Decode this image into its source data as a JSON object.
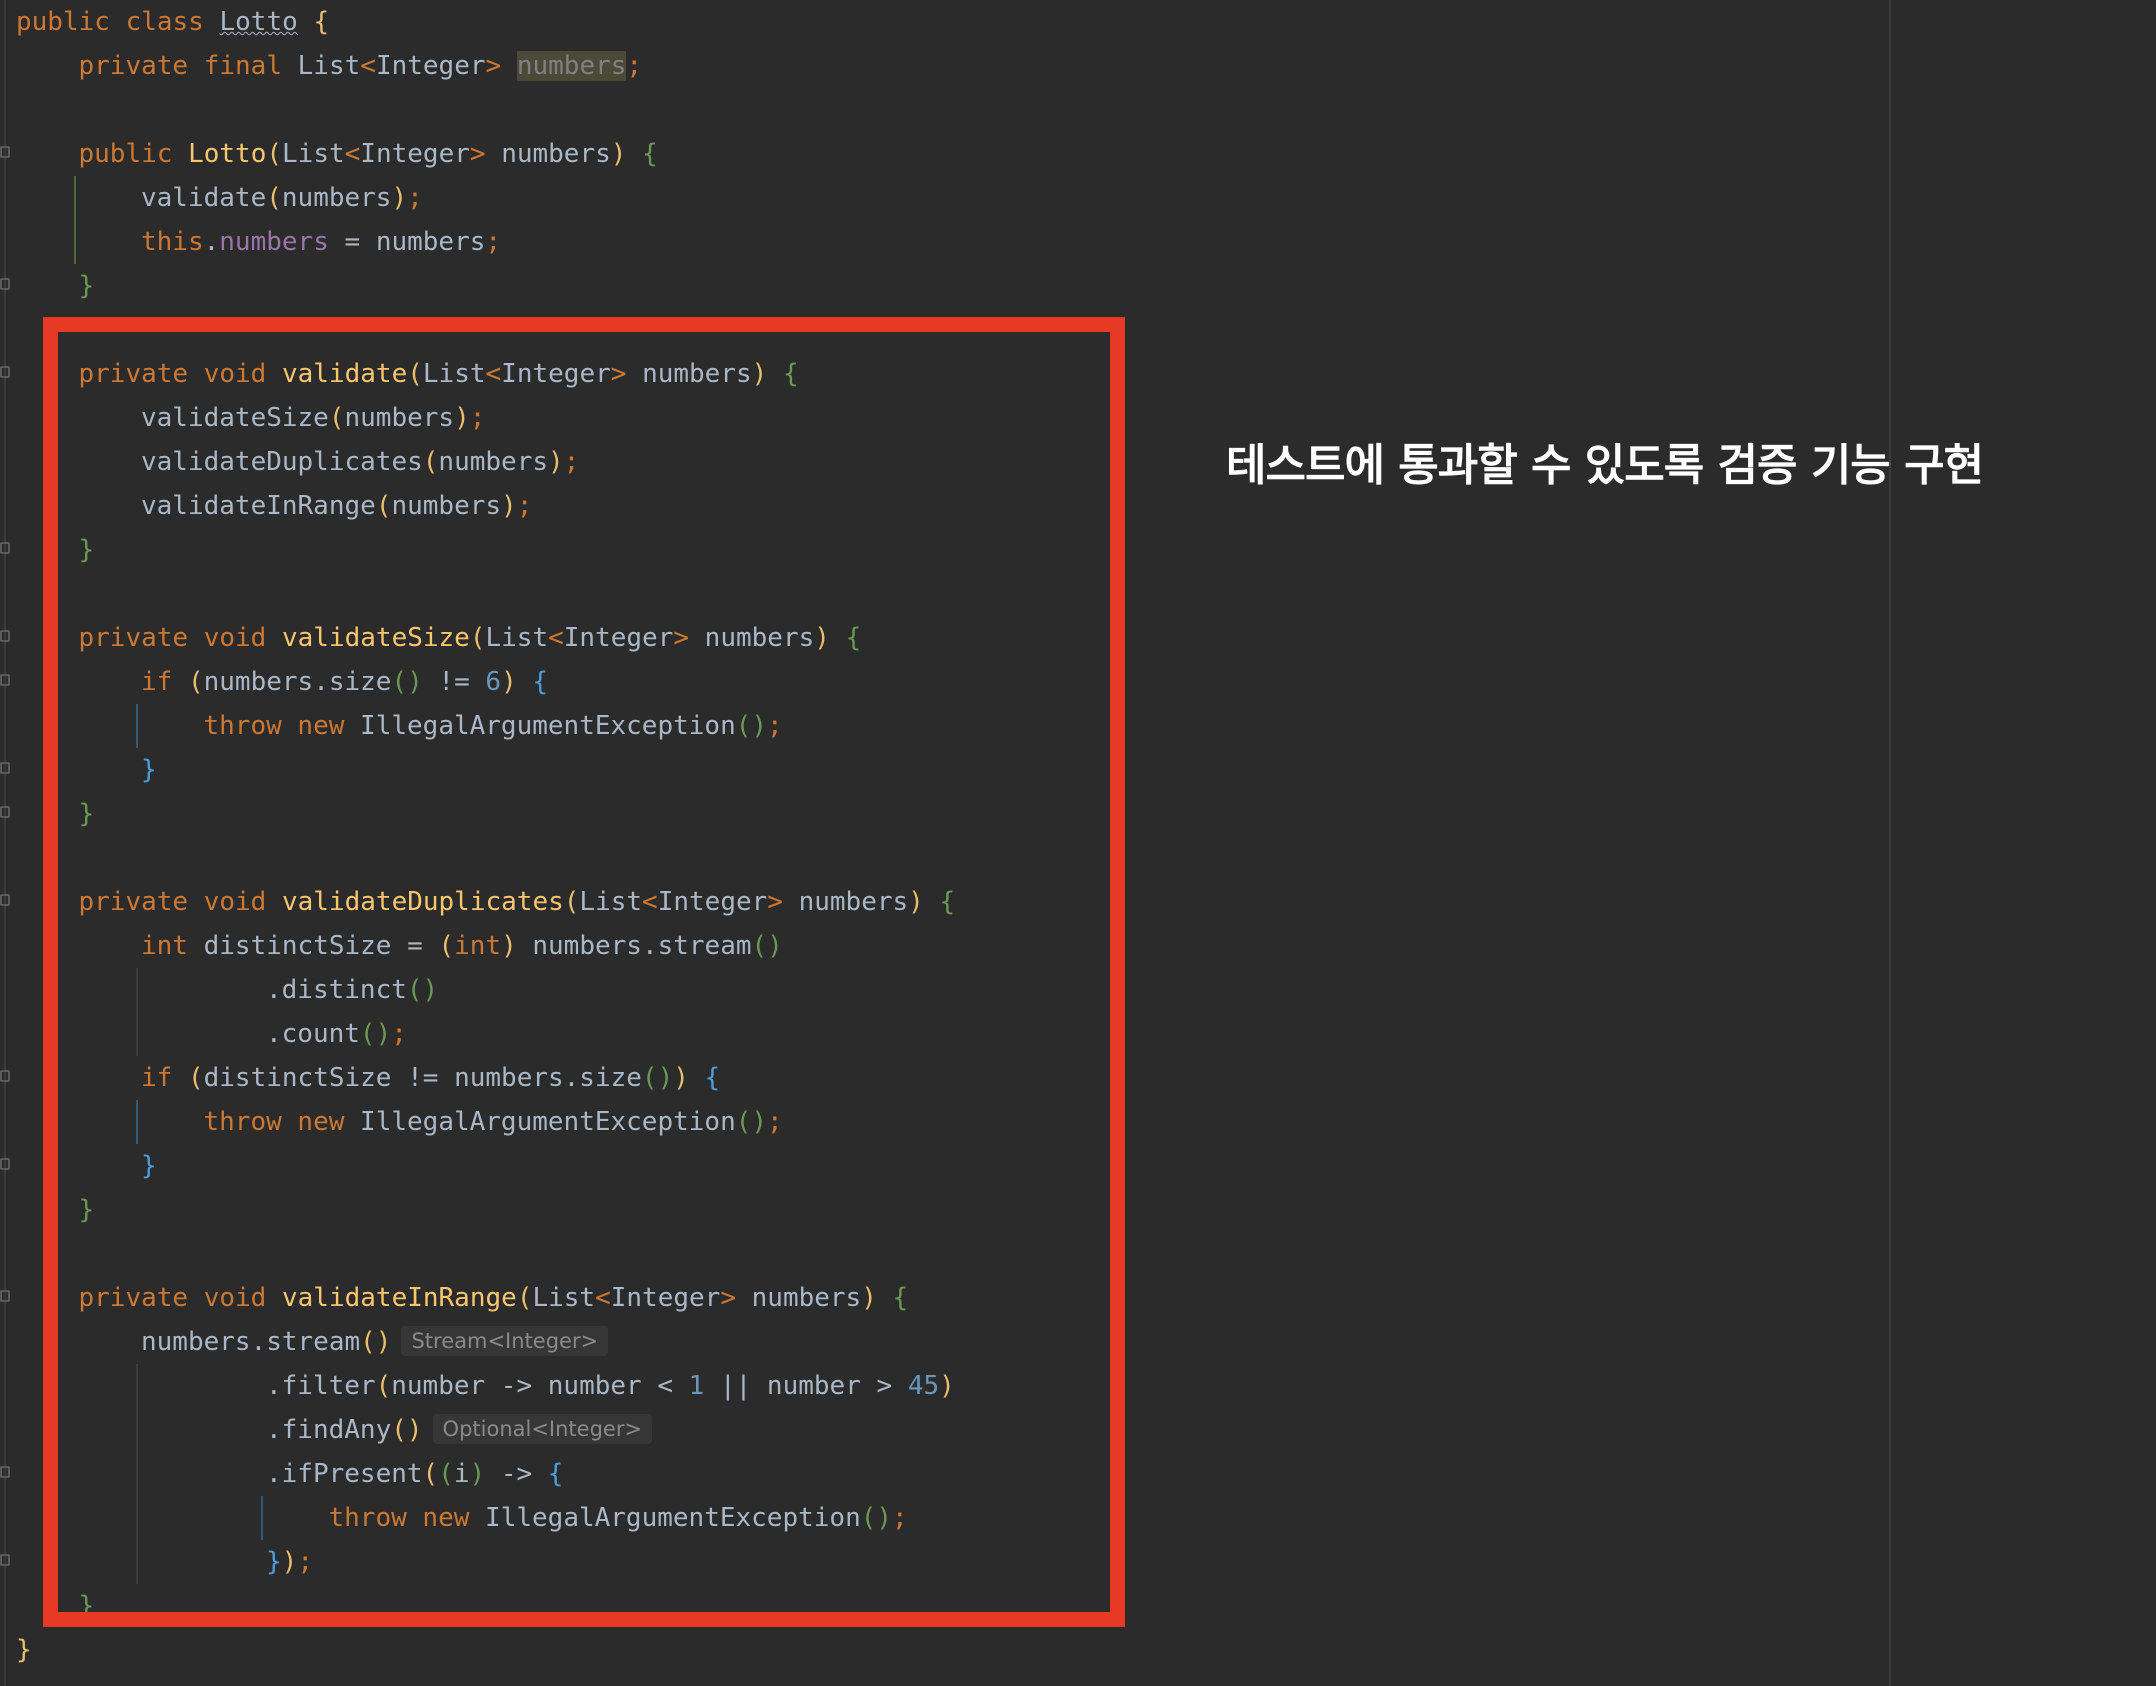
{
  "editor": {
    "lines": [
      {
        "indent": 0,
        "tokens": [
          [
            "kw",
            "public class "
          ],
          [
            "txtw",
            "Lotto"
          ],
          [
            "txt",
            " "
          ],
          [
            "bp",
            "{"
          ]
        ]
      },
      {
        "indent": 1,
        "tokens": [
          [
            "kw",
            "private final "
          ],
          [
            "txt",
            "List"
          ],
          [
            "kw",
            "<"
          ],
          [
            "txt",
            "Integer"
          ],
          [
            "kw",
            "> "
          ],
          [
            "hl",
            "numbers"
          ],
          [
            "kw",
            ";"
          ]
        ]
      },
      {
        "indent": 0,
        "tokens": []
      },
      {
        "indent": 1,
        "tokens": [
          [
            "kw",
            "public "
          ],
          [
            "fn",
            "Lotto"
          ],
          [
            "bp",
            "("
          ],
          [
            "txt",
            "List"
          ],
          [
            "kw",
            "<"
          ],
          [
            "txt",
            "Integer"
          ],
          [
            "kw",
            "> "
          ],
          [
            "txt",
            "numbers"
          ],
          [
            "bp",
            ")"
          ],
          [
            "txt",
            " "
          ],
          [
            "bg",
            "{"
          ]
        ]
      },
      {
        "indent": 2,
        "tokens": [
          [
            "txt",
            "validate"
          ],
          [
            "bp",
            "("
          ],
          [
            "txt",
            "numbers"
          ],
          [
            "bp",
            ")"
          ],
          [
            "kw",
            ";"
          ]
        ]
      },
      {
        "indent": 2,
        "tokens": [
          [
            "kw",
            "this"
          ],
          [
            "txt",
            "."
          ],
          [
            "fld",
            "numbers"
          ],
          [
            "txt",
            " = numbers"
          ],
          [
            "kw",
            ";"
          ]
        ]
      },
      {
        "indent": 1,
        "tokens": [
          [
            "bg",
            "}"
          ]
        ]
      },
      {
        "indent": 0,
        "tokens": []
      },
      {
        "indent": 1,
        "tokens": [
          [
            "kw",
            "private void "
          ],
          [
            "fn",
            "validate"
          ],
          [
            "bp",
            "("
          ],
          [
            "txt",
            "List"
          ],
          [
            "kw",
            "<"
          ],
          [
            "txt",
            "Integer"
          ],
          [
            "kw",
            "> "
          ],
          [
            "txt",
            "numbers"
          ],
          [
            "bp",
            ")"
          ],
          [
            "txt",
            " "
          ],
          [
            "bg",
            "{"
          ]
        ]
      },
      {
        "indent": 2,
        "tokens": [
          [
            "txt",
            "validateSize"
          ],
          [
            "bp",
            "("
          ],
          [
            "txt",
            "numbers"
          ],
          [
            "bp",
            ")"
          ],
          [
            "kw",
            ";"
          ]
        ]
      },
      {
        "indent": 2,
        "tokens": [
          [
            "txt",
            "validateDuplicates"
          ],
          [
            "bp",
            "("
          ],
          [
            "txt",
            "numbers"
          ],
          [
            "bp",
            ")"
          ],
          [
            "kw",
            ";"
          ]
        ]
      },
      {
        "indent": 2,
        "tokens": [
          [
            "txt",
            "validateInRange"
          ],
          [
            "bp",
            "("
          ],
          [
            "txt",
            "numbers"
          ],
          [
            "bp",
            ")"
          ],
          [
            "kw",
            ";"
          ]
        ]
      },
      {
        "indent": 1,
        "tokens": [
          [
            "bg",
            "}"
          ]
        ]
      },
      {
        "indent": 0,
        "tokens": []
      },
      {
        "indent": 1,
        "tokens": [
          [
            "kw",
            "private void "
          ],
          [
            "fn",
            "validateSize"
          ],
          [
            "bp",
            "("
          ],
          [
            "txt",
            "List"
          ],
          [
            "kw",
            "<"
          ],
          [
            "txt",
            "Integer"
          ],
          [
            "kw",
            "> "
          ],
          [
            "txt",
            "numbers"
          ],
          [
            "bp",
            ")"
          ],
          [
            "txt",
            " "
          ],
          [
            "bg",
            "{"
          ]
        ]
      },
      {
        "indent": 2,
        "tokens": [
          [
            "kw",
            "if "
          ],
          [
            "bp",
            "("
          ],
          [
            "txt",
            "numbers.size"
          ],
          [
            "bg",
            "()"
          ],
          [
            "txt",
            " != "
          ],
          [
            "num",
            "6"
          ],
          [
            "bp",
            ")"
          ],
          [
            "txt",
            " "
          ],
          [
            "bb",
            "{"
          ]
        ]
      },
      {
        "indent": 3,
        "tokens": [
          [
            "kw",
            "throw new "
          ],
          [
            "txt",
            "IllegalArgumentException"
          ],
          [
            "bg",
            "()"
          ],
          [
            "kw",
            ";"
          ]
        ]
      },
      {
        "indent": 2,
        "tokens": [
          [
            "bb",
            "}"
          ]
        ]
      },
      {
        "indent": 1,
        "tokens": [
          [
            "bg",
            "}"
          ]
        ]
      },
      {
        "indent": 0,
        "tokens": []
      },
      {
        "indent": 1,
        "tokens": [
          [
            "kw",
            "private void "
          ],
          [
            "fn",
            "validateDuplicates"
          ],
          [
            "bp",
            "("
          ],
          [
            "txt",
            "List"
          ],
          [
            "kw",
            "<"
          ],
          [
            "txt",
            "Integer"
          ],
          [
            "kw",
            "> "
          ],
          [
            "txt",
            "numbers"
          ],
          [
            "bp",
            ")"
          ],
          [
            "txt",
            " "
          ],
          [
            "bg",
            "{"
          ]
        ]
      },
      {
        "indent": 2,
        "tokens": [
          [
            "kw",
            "int "
          ],
          [
            "txt",
            "distinctSize = "
          ],
          [
            "bp",
            "("
          ],
          [
            "kw",
            "int"
          ],
          [
            "bp",
            ")"
          ],
          [
            "txt",
            " numbers.stream"
          ],
          [
            "bg",
            "()"
          ]
        ]
      },
      {
        "indent": 4,
        "tokens": [
          [
            "txt",
            ".distinct"
          ],
          [
            "bg",
            "()"
          ]
        ]
      },
      {
        "indent": 4,
        "tokens": [
          [
            "txt",
            ".count"
          ],
          [
            "bg",
            "()"
          ],
          [
            "kw",
            ";"
          ]
        ]
      },
      {
        "indent": 2,
        "tokens": [
          [
            "kw",
            "if "
          ],
          [
            "bp",
            "("
          ],
          [
            "txt",
            "distinctSize != numbers.size"
          ],
          [
            "bg",
            "()"
          ],
          [
            "bp",
            ")"
          ],
          [
            "txt",
            " "
          ],
          [
            "bb",
            "{"
          ]
        ]
      },
      {
        "indent": 3,
        "tokens": [
          [
            "kw",
            "throw new "
          ],
          [
            "txt",
            "IllegalArgumentException"
          ],
          [
            "bg",
            "()"
          ],
          [
            "kw",
            ";"
          ]
        ]
      },
      {
        "indent": 2,
        "tokens": [
          [
            "bb",
            "}"
          ]
        ]
      },
      {
        "indent": 1,
        "tokens": [
          [
            "bg",
            "}"
          ]
        ]
      },
      {
        "indent": 0,
        "tokens": []
      },
      {
        "indent": 1,
        "tokens": [
          [
            "kw",
            "private void "
          ],
          [
            "fn",
            "validateInRange"
          ],
          [
            "bp",
            "("
          ],
          [
            "txt",
            "List"
          ],
          [
            "kw",
            "<"
          ],
          [
            "txt",
            "Integer"
          ],
          [
            "kw",
            "> "
          ],
          [
            "txt",
            "numbers"
          ],
          [
            "bp",
            ")"
          ],
          [
            "txt",
            " "
          ],
          [
            "bg",
            "{"
          ]
        ]
      },
      {
        "indent": 2,
        "tokens": [
          [
            "txt",
            "numbers.stream"
          ],
          [
            "bp",
            "()"
          ]
        ],
        "hint": "Stream<Integer>"
      },
      {
        "indent": 4,
        "tokens": [
          [
            "txt",
            ".filter"
          ],
          [
            "bp",
            "("
          ],
          [
            "txt",
            "number -> number < "
          ],
          [
            "num",
            "1"
          ],
          [
            "txt",
            " || number > "
          ],
          [
            "num",
            "45"
          ],
          [
            "bp",
            ")"
          ]
        ]
      },
      {
        "indent": 4,
        "tokens": [
          [
            "txt",
            ".findAny"
          ],
          [
            "bp",
            "()"
          ]
        ],
        "hint": "Optional<Integer>"
      },
      {
        "indent": 4,
        "tokens": [
          [
            "txt",
            ".ifPresent"
          ],
          [
            "bp",
            "("
          ],
          [
            "bg",
            "("
          ],
          [
            "txt",
            "i"
          ],
          [
            "bg",
            ")"
          ],
          [
            "txt",
            " -> "
          ],
          [
            "bb",
            "{"
          ]
        ]
      },
      {
        "indent": 5,
        "tokens": [
          [
            "kw",
            "throw new "
          ],
          [
            "txt",
            "IllegalArgumentException"
          ],
          [
            "bg",
            "()"
          ],
          [
            "kw",
            ";"
          ]
        ]
      },
      {
        "indent": 4,
        "tokens": [
          [
            "bb",
            "}"
          ],
          [
            "bp",
            ")"
          ],
          [
            "kw",
            ";"
          ]
        ]
      },
      {
        "indent": 1,
        "tokens": [
          [
            "bg",
            "}"
          ]
        ]
      },
      {
        "indent": 0,
        "tokens": [
          [
            "bp",
            "}"
          ]
        ]
      }
    ]
  },
  "annotation": {
    "text": "테스트에 통과할 수 있도록 검증 기능 구현",
    "color": "#ffffff"
  },
  "colors": {
    "background": "#2b2b2b",
    "highlight_box": "#e63a23",
    "keyword": "#cc7832",
    "method": "#ffc66d",
    "number": "#6897bb",
    "field": "#9876aa",
    "text": "#a9b7c6"
  }
}
